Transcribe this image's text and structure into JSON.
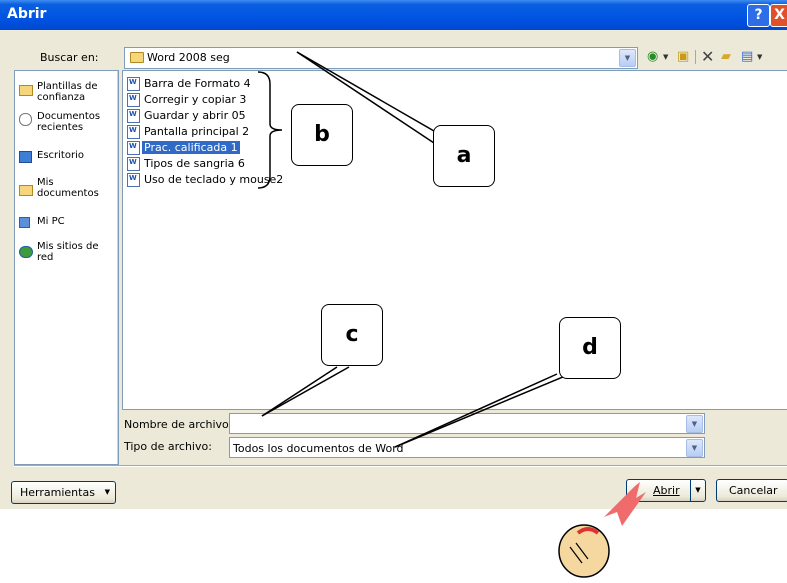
{
  "window": {
    "title": "Abrir",
    "help_glyph": "?",
    "close_glyph": "X"
  },
  "lookin": {
    "label": "Buscar en:",
    "value": "Word 2008 seg"
  },
  "toolbar": {
    "icons": [
      "back-icon",
      "up-folder-icon",
      "delete-icon",
      "new-folder-icon",
      "views-icon"
    ]
  },
  "places": [
    {
      "label": "Plantillas de confianza",
      "icon": "folder-icon"
    },
    {
      "label": "Documentos recientes",
      "icon": "recent-documents-icon"
    },
    {
      "label": "Escritorio",
      "icon": "desktop-icon"
    },
    {
      "label": "Mis documentos",
      "icon": "my-documents-icon"
    },
    {
      "label": "Mi PC",
      "icon": "my-computer-icon"
    },
    {
      "label": "Mis sitios de red",
      "icon": "network-places-icon"
    }
  ],
  "files": [
    {
      "name": "Barra de Formato 4",
      "selected": false
    },
    {
      "name": "Corregir y copiar 3",
      "selected": false
    },
    {
      "name": "Guardar y abrir 05",
      "selected": false
    },
    {
      "name": "Pantalla principal 2",
      "selected": false
    },
    {
      "name": "Prac. calificada 1",
      "selected": true
    },
    {
      "name": "Tipos de sangria 6",
      "selected": false
    },
    {
      "name": "Uso de teclado y mouse2",
      "selected": false
    }
  ],
  "filename": {
    "label": "Nombre de archivo:",
    "value": ""
  },
  "filetype": {
    "label": "Tipo de archivo:",
    "value": "Todos los documentos de Word"
  },
  "buttons": {
    "tools": "Herramientas",
    "open": "Abrir",
    "cancel": "Cancelar"
  },
  "callouts": {
    "a": "a",
    "b": "b",
    "c": "c",
    "d": "d"
  },
  "colors": {
    "titlebar": "#0054e3",
    "selection": "#316ac5",
    "dialog_bg": "#ece9d8",
    "arrow": "#f06c6c"
  }
}
